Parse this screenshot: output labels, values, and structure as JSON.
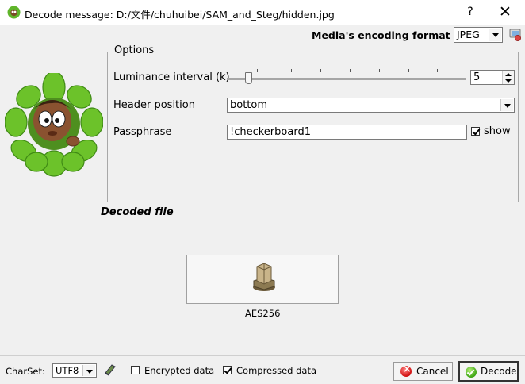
{
  "window": {
    "title": "Decode message: D:/文件/chuhuibei/SAM_and_Steg/hidden.jpg",
    "help_label": "?",
    "close_label": "✕"
  },
  "format": {
    "label": "Media's encoding format :",
    "selected": "JPEG"
  },
  "options": {
    "legend": "Options",
    "luminance": {
      "label": "Luminance interval (k)",
      "value": "5",
      "slider_fraction": 0.09
    },
    "header_position": {
      "label": "Header position",
      "selected": "bottom"
    },
    "passphrase": {
      "label": "Passphrase",
      "value": "!checkerboard1",
      "show_label": "show",
      "show_checked": true
    }
  },
  "decoded": {
    "label": "Decoded file",
    "button_caption": "AES256",
    "button_icon": "package-icon"
  },
  "footer": {
    "charset_label": "CharSet:",
    "charset_selected": "UTF8",
    "encrypted_label": "Encrypted data",
    "encrypted_checked": false,
    "compressed_label": "Compressed data",
    "compressed_checked": true,
    "cancel_label": "Cancel",
    "decode_label": "Decode"
  },
  "colors": {
    "window_bg": "#f0f0f0",
    "cancel_icon": "#d01010",
    "decode_icon": "#3da514",
    "mascot_leaves": "#6cc22a"
  }
}
